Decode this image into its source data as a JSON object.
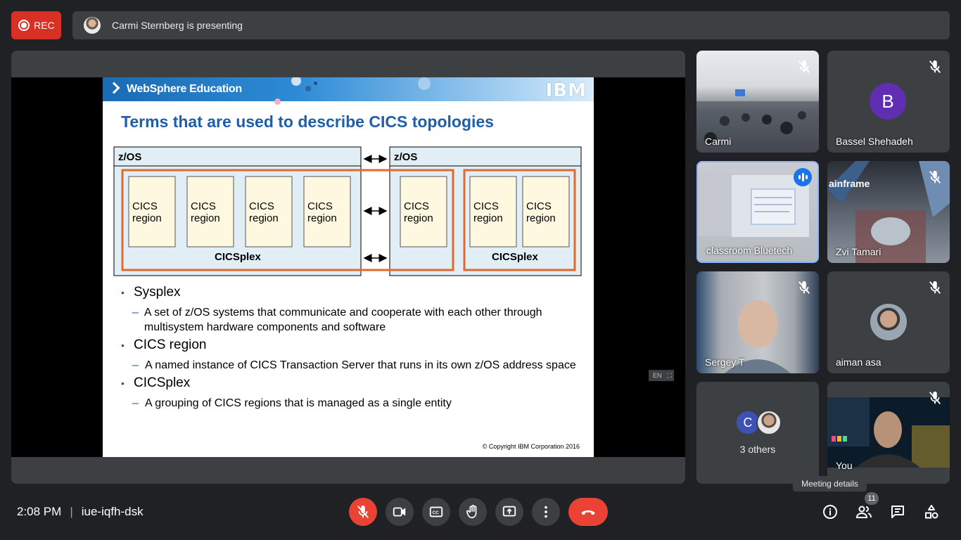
{
  "recording": {
    "label": "REC"
  },
  "presenting": {
    "text": "Carmi Sternberg is presenting"
  },
  "slide": {
    "brand": "WebSphere Education",
    "logo": "IBM",
    "title": "Terms that are used to describe CICS topologies",
    "diagram": {
      "zos_left": "z/OS",
      "zos_right": "z/OS",
      "region_line1": "CICS",
      "region_line2": "region",
      "cicsplex": "CICSplex"
    },
    "bullets": [
      {
        "term": "Sysplex",
        "desc": "A set of z/OS systems that communicate and cooperate with each other through multisystem hardware components and software"
      },
      {
        "term": "CICS region",
        "desc": "A named instance of CICS Transaction Server that runs in its own z/OS address space"
      },
      {
        "term": "CICSplex",
        "desc": "A grouping of CICS regions that is managed as a single entity"
      }
    ],
    "copyright": "© Copyright IBM Corporation 2016"
  },
  "lang_indicator": "EN",
  "participants": [
    {
      "name": "Carmi",
      "muted": true
    },
    {
      "name": "Bassel Shehadeh",
      "initial": "B",
      "muted": true
    },
    {
      "name": "classroom Bluetech",
      "speaking": true
    },
    {
      "name": "Zvi Tamari",
      "muted": true,
      "overlay": "ainframe"
    },
    {
      "name": "Sergey T",
      "muted": true
    },
    {
      "name": "aiman asa",
      "muted": true
    },
    {
      "name": "3 others",
      "initial": "C"
    },
    {
      "name": "You",
      "muted": true
    }
  ],
  "bottom": {
    "time": "2:08 PM",
    "separator": "|",
    "meeting_code": "iue-iqfh-dsk",
    "tooltip": "Meeting details",
    "people_count": "11"
  },
  "colors": {
    "accent": "#8ab4f8",
    "danger": "#ea4335",
    "surface": "#3c4043",
    "background": "#202124",
    "slide_blue": "#1f5fa8",
    "cicsplex_orange": "#e06a2c"
  }
}
